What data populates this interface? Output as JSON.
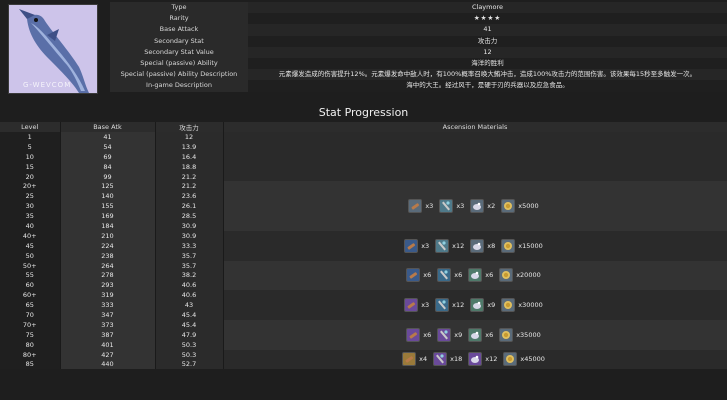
{
  "weapon": {
    "watermark": "G-WEVCOM",
    "info_rows": [
      {
        "key": "Type",
        "value": "Claymore"
      },
      {
        "key": "Rarity",
        "value": "★★★★"
      },
      {
        "key": "Base Attack",
        "value": "41"
      },
      {
        "key": "Secondary Stat",
        "value": "攻击力"
      },
      {
        "key": "Secondary Stat Value",
        "value": "12"
      },
      {
        "key": "Special (passive) Ability",
        "value": "海洋的胜利"
      },
      {
        "key": "Special (passive) Ability Description",
        "value": "元素爆发造成的伤害提升12%。元素爆发命中敌人时，有100%概率召唤大鲔冲击，造成100%攻击力的范围伤害。该效果每15秒至多触发一次。"
      },
      {
        "key": "In-game Description",
        "value": "海中的大王。经过风干，是硬于刃的兵器以及应急食品。"
      }
    ]
  },
  "progression": {
    "title": "Stat Progression",
    "headers": [
      "Level",
      "Base Atk",
      "攻击力",
      "Ascension Materials"
    ],
    "rows": [
      [
        "1",
        "41",
        "12"
      ],
      [
        "5",
        "54",
        "13.9"
      ],
      [
        "10",
        "69",
        "16.4"
      ],
      [
        "15",
        "84",
        "18.8"
      ],
      [
        "20",
        "99",
        "21.2"
      ],
      [
        "20+",
        "125",
        "21.2"
      ],
      [
        "25",
        "140",
        "23.6"
      ],
      [
        "30",
        "155",
        "26.1"
      ],
      [
        "35",
        "169",
        "28.5"
      ],
      [
        "40",
        "184",
        "30.9"
      ],
      [
        "40+",
        "210",
        "30.9"
      ],
      [
        "45",
        "224",
        "33.3"
      ],
      [
        "50",
        "238",
        "35.7"
      ],
      [
        "50+",
        "264",
        "35.7"
      ],
      [
        "55",
        "278",
        "38.2"
      ],
      [
        "60",
        "293",
        "40.6"
      ],
      [
        "60+",
        "319",
        "40.6"
      ],
      [
        "65",
        "333",
        "43"
      ],
      [
        "70",
        "347",
        "45.4"
      ],
      [
        "70+",
        "373",
        "45.4"
      ],
      [
        "75",
        "387",
        "47.9"
      ],
      [
        "80",
        "401",
        "50.3"
      ],
      [
        "80+",
        "427",
        "50.3"
      ],
      [
        "85",
        "440",
        "52.7"
      ]
    ],
    "materials": [
      {
        "items": [
          {
            "icon": "domain-item-icon",
            "qty": "x3",
            "color": "#5a6b7a"
          },
          {
            "icon": "elite-drop-icon",
            "qty": "x3",
            "color": "#4f7a8a"
          },
          {
            "icon": "common-drop-icon",
            "qty": "x2",
            "color": "#5a6b7a"
          },
          {
            "icon": "mora-icon",
            "qty": "x5000",
            "color": "#5a6b7a"
          }
        ]
      },
      {
        "items": [
          {
            "icon": "domain-item-icon",
            "qty": "x3",
            "color": "#3a5a8a"
          },
          {
            "icon": "elite-drop-icon",
            "qty": "x12",
            "color": "#4f7a8a"
          },
          {
            "icon": "common-drop-icon",
            "qty": "x8",
            "color": "#5a6b7a"
          },
          {
            "icon": "mora-icon",
            "qty": "x15000",
            "color": "#5a6b7a"
          }
        ]
      },
      {
        "items": [
          {
            "icon": "domain-item-icon",
            "qty": "x6",
            "color": "#3a5a8a"
          },
          {
            "icon": "elite-drop-icon",
            "qty": "x6",
            "color": "#3a6a8a"
          },
          {
            "icon": "common-drop-icon",
            "qty": "x6",
            "color": "#4f7a6a"
          },
          {
            "icon": "mora-icon",
            "qty": "x20000",
            "color": "#5a6b7a"
          }
        ]
      },
      {
        "items": [
          {
            "icon": "domain-item-icon",
            "qty": "x3",
            "color": "#6a4a9a"
          },
          {
            "icon": "elite-drop-icon",
            "qty": "x12",
            "color": "#3a6a8a"
          },
          {
            "icon": "common-drop-icon",
            "qty": "x9",
            "color": "#4f7a6a"
          },
          {
            "icon": "mora-icon",
            "qty": "x30000",
            "color": "#5a6b7a"
          }
        ]
      },
      {
        "items": [
          {
            "icon": "domain-item-icon",
            "qty": "x6",
            "color": "#6a4a9a"
          },
          {
            "icon": "elite-drop-icon",
            "qty": "x9",
            "color": "#6a4a9a"
          },
          {
            "icon": "common-drop-icon",
            "qty": "x6",
            "color": "#4f7a6a"
          },
          {
            "icon": "mora-icon",
            "qty": "x35000",
            "color": "#5a6b7a"
          }
        ]
      },
      {
        "items": [
          {
            "icon": "domain-item-icon",
            "qty": "x4",
            "color": "#9a7a3a"
          },
          {
            "icon": "elite-drop-icon",
            "qty": "x18",
            "color": "#6a4a9a"
          },
          {
            "icon": "common-drop-icon",
            "qty": "x12",
            "color": "#6a4a9a"
          },
          {
            "icon": "mora-icon",
            "qty": "x45000",
            "color": "#5a6b7a"
          }
        ]
      }
    ]
  }
}
